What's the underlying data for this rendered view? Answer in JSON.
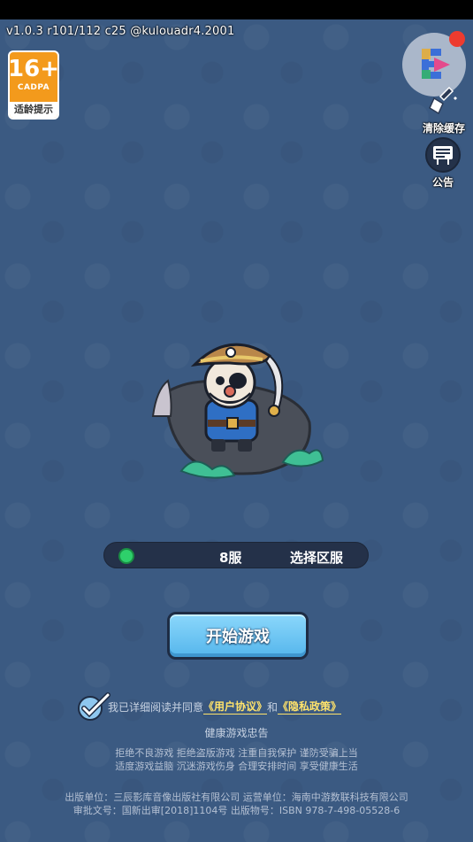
{
  "version_text": "v1.0.3 r101/112 c25 @kulouadr4.2001",
  "age_rating": {
    "number": "16+",
    "org": "CADPA",
    "tip": "适龄提示",
    "color": "#f39a1c"
  },
  "side_buttons": {
    "clear_cache": {
      "label": "清除缓存",
      "icon": "broom-icon"
    },
    "notice": {
      "label": "公告",
      "icon": "notice-board-icon"
    }
  },
  "floating_logo": {
    "icon": "app-logo-icon",
    "has_notification": true
  },
  "server": {
    "status": "online",
    "status_color": "#2ed06b",
    "name": "8服",
    "select_label": "选择区服"
  },
  "start_button": {
    "label": "开始游戏"
  },
  "agreement": {
    "checked": true,
    "prefix": "我已详细阅读并同意",
    "user_agreement": "《用户协议》",
    "and": "和",
    "privacy_policy": "《隐私政策》"
  },
  "health_advice": {
    "title": "健康游戏忠告",
    "line1": "拒绝不良游戏  拒绝盗版游戏  注重自我保护  谨防受骗上当",
    "line2": "适度游戏益脑  沉迷游戏伤身  合理安排时间  享受健康生活"
  },
  "publication": {
    "line1": "出版单位：三辰影库音像出版社有限公司   运营单位：海南中游数联科技有限公司",
    "line2": "审批文号：国新出审[2018]1104号   出版物号：ISBN 978-7-498-05528-6"
  }
}
